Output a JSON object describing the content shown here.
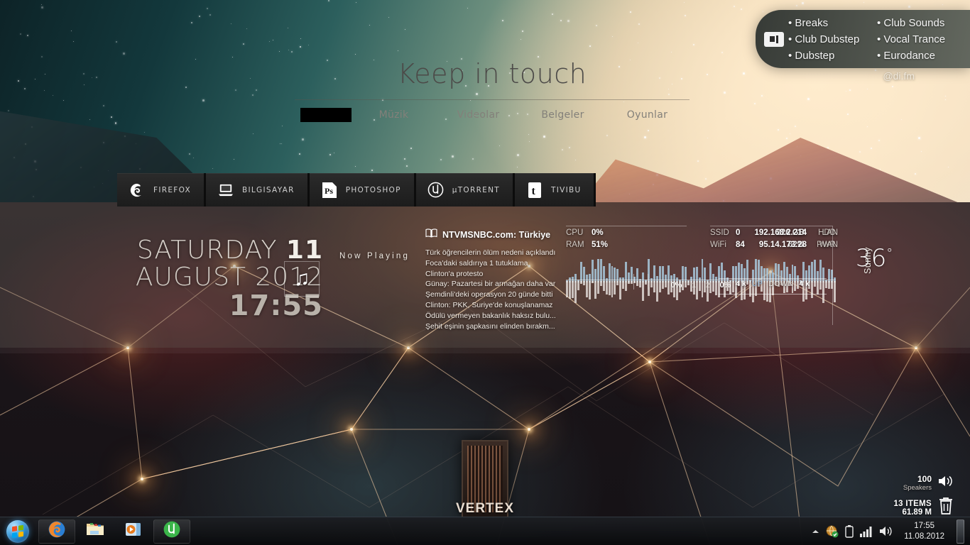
{
  "difm": {
    "logo_icon": "di-fm-logo-icon",
    "column_left": [
      "Breaks",
      "Club Dubstep",
      "Dubstep"
    ],
    "column_right": [
      "Club Sounds",
      "Vocal Trance",
      "Eurodance"
    ],
    "handle": "@di.fm"
  },
  "keep_in_touch": {
    "title": "Keep in touch",
    "tabs": [
      {
        "label": "",
        "redacted": true
      },
      {
        "label": "Müzik",
        "redacted": false
      },
      {
        "label": "Videolar",
        "redacted": false
      },
      {
        "label": "Belgeler",
        "redacted": false
      },
      {
        "label": "Oyunlar",
        "redacted": false
      }
    ]
  },
  "dock": {
    "items": [
      {
        "label": "FIREFOX",
        "icon": "firefox-icon"
      },
      {
        "label": "BILGISAYAR",
        "icon": "computer-icon"
      },
      {
        "label": "PHOTOSHOP",
        "icon": "photoshop-icon"
      },
      {
        "label": "µTORRENT",
        "icon": "utorrent-icon"
      },
      {
        "label": "TIVIBU",
        "icon": "tivibu-icon"
      }
    ]
  },
  "clock_widget": {
    "weekday": "SATURDAY",
    "day": "11",
    "month_year": "AUGUST 2012",
    "time": "17:55"
  },
  "now_playing": {
    "label": "Now Playing",
    "icon": "music-note-icon"
  },
  "news": {
    "icon": "book-icon",
    "source": "NTVMSNBC.com: Türkiye",
    "headlines": [
      "Türk öğrencilerin ölüm nedeni açıklandı",
      "Foca'daki saldırıya 1 tutuklama",
      "Clinton'a protesto",
      "Günay: Pazartesi bir armağan daha var",
      "Şemdinli'deki operasyon 20 günde bitti",
      "Clinton: PKK, Suriye'de konuşlanamaz",
      "Ödülü vermeyen bakanlık haksız bulu...",
      "Şehit eşinin şapkasını elinden bırakm..."
    ]
  },
  "sysmon": {
    "cpu_key": "CPU",
    "cpu_value": "0%",
    "ram_key": "RAM",
    "ram_value": "51%",
    "hdd_key": "HDD",
    "hdd_value": "226 GB",
    "pwr_key": "PWR",
    "pwr_value": "62%",
    "ssid_key": "SSID",
    "ssid_value": "0",
    "wifi_key": "WiFi",
    "wifi_value": "84",
    "lan_key": "LAN",
    "lan_value": "192.168.2.214",
    "wan_key": "WAN",
    "wan_value": "95.14.173.28",
    "core1_left_pct": "0%",
    "core1_label": "1",
    "core2_label": "2",
    "core2_right_pct": "0%",
    "up_value": "4 k",
    "up_label": "UP",
    "down_label": "DOWN",
    "down_value": "4 k"
  },
  "weather": {
    "temperature": "36",
    "degree": "°",
    "condition": "Sunny"
  },
  "desktop_info": {
    "volume_value": "100",
    "volume_label": "Speakers",
    "volume_icon": "speaker-icon",
    "bin_count": "13 ITEMS",
    "bin_size": "61.89 M",
    "bin_icon": "recycle-bin-icon"
  },
  "wallpaper": {
    "poster_text": "VERTEX"
  },
  "taskbar": {
    "start_icon": "windows-start-orb-icon",
    "buttons": [
      {
        "icon": "firefox-icon",
        "name": "taskbar-firefox"
      },
      {
        "icon": "file-explorer-icon",
        "name": "taskbar-explorer"
      },
      {
        "icon": "media-player-icon",
        "name": "taskbar-media-player"
      },
      {
        "icon": "utorrent-icon",
        "name": "taskbar-utorrent"
      }
    ],
    "tray": {
      "overflow_icon": "show-hidden-icons-arrow",
      "network_icon": "network-globe-icon",
      "battery_icon": "battery-icon",
      "signal_icon": "signal-bars-icon",
      "speaker_icon": "volume-speaker-icon"
    },
    "clock_time": "17:55",
    "clock_date": "11.08.2012"
  },
  "colors": {
    "dock_bg": "#232323",
    "difm_bg": "#4e5650",
    "accent_blue": "#8fb4d6",
    "taskbar_bg": "#0a0b0d"
  }
}
